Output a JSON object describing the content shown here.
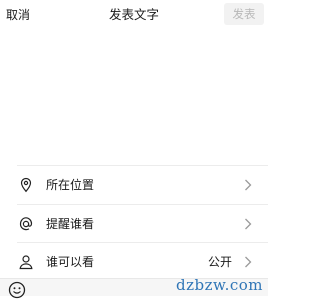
{
  "header": {
    "cancel_label": "取消",
    "title": "发表文字",
    "publish_label": "发表"
  },
  "options": [
    {
      "label": "所在位置",
      "icon": "location-pin-icon",
      "value": ""
    },
    {
      "label": "提醒谁看",
      "icon": "at-sign-icon",
      "value": ""
    },
    {
      "label": "谁可以看",
      "icon": "person-icon",
      "value": "公开"
    }
  ],
  "watermark": "dzbzw.com",
  "colors": {
    "publish_disabled_bg": "#f2f2f2",
    "publish_disabled_text": "#b8b8b8",
    "watermark": "#2f75b6"
  }
}
